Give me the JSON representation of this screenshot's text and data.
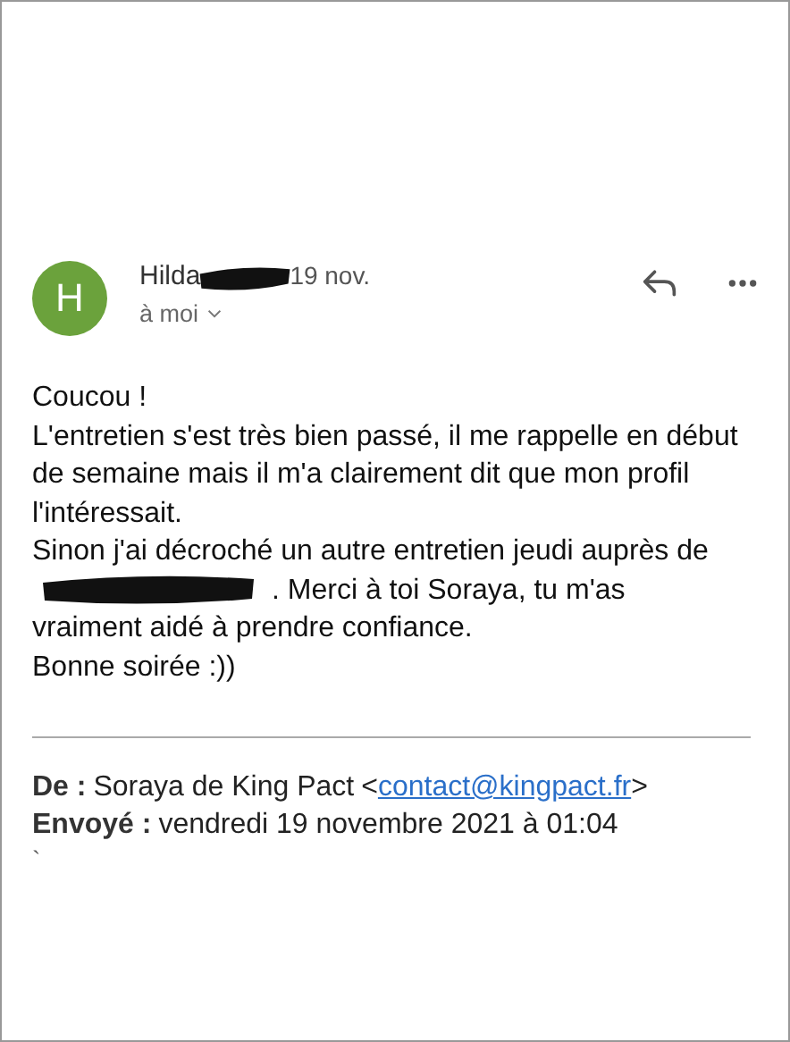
{
  "header": {
    "avatar_letter": "H",
    "sender": "Hilda",
    "date": "19 nov.",
    "recipient": "à moi",
    "redacted": true
  },
  "body": {
    "lines": [
      {
        "text": "Coucou !",
        "redacted_prefix": false
      },
      {
        "text": "L'entretien s'est très bien passé, il me rappelle en début",
        "redacted_prefix": false
      },
      {
        "text": "de semaine mais il m'a clairement dit que mon profil",
        "redacted_prefix": false
      },
      {
        "text": "l'intéressait.",
        "redacted_prefix": false
      },
      {
        "text": "Sinon j'ai décroché un autre entretien jeudi auprès de",
        "redacted_prefix": false
      },
      {
        "text": ". Merci à toi Soraya, tu m'as",
        "redacted_prefix": true
      },
      {
        "text": "vraiment aidé à prendre confiance.",
        "redacted_prefix": false
      },
      {
        "text": "Bonne soirée :))",
        "redacted_prefix": false
      }
    ]
  },
  "quoted": {
    "from_label": "De :",
    "from_name": "Soraya de King Pact",
    "email_open": "<",
    "email": "contact@kingpact.fr",
    "email_close": ">",
    "sent_label": "Envoyé :",
    "sent_value": "vendredi 19 novembre 2021 à 01:04",
    "fragment": "`"
  }
}
